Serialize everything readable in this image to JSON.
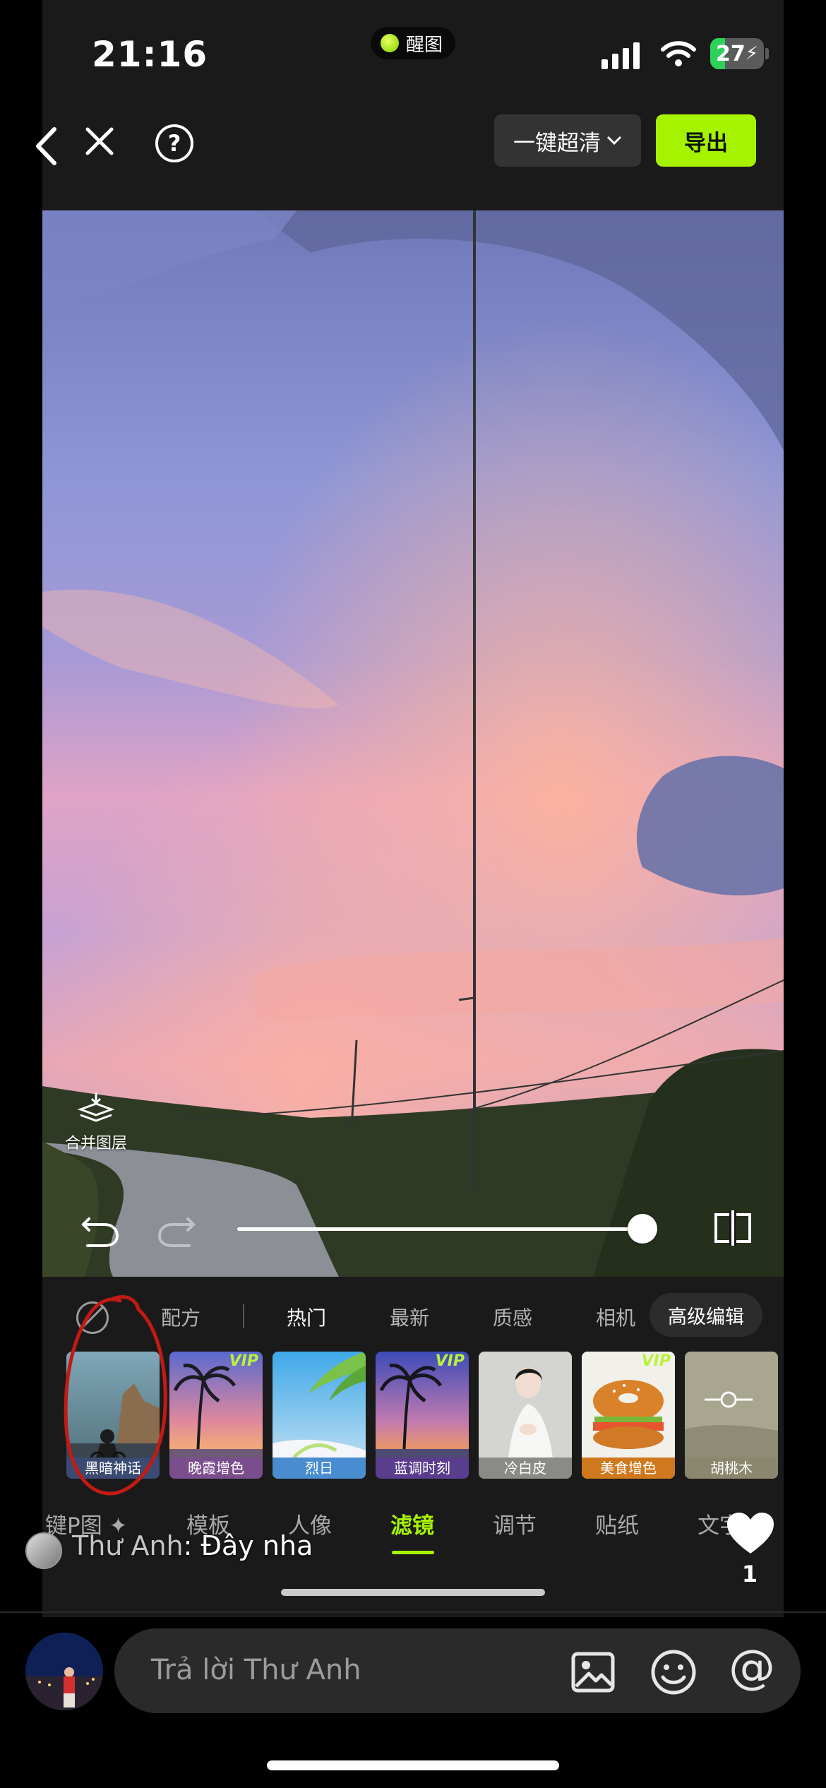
{
  "status_bar": {
    "time": "21:16",
    "island_label": "醒图",
    "battery": "27"
  },
  "toolbar": {
    "enhance_label": "一键超清",
    "export_label": "导出"
  },
  "canvas": {
    "merge_layers_label": "合并图层",
    "intensity_percent": 100
  },
  "filter_categories": {
    "items": [
      "配方",
      "热门",
      "最新",
      "质感",
      "相机"
    ],
    "active": "热门",
    "advanced_edit": "高级编辑"
  },
  "filters": [
    {
      "name": "黑暗神话",
      "vip": false
    },
    {
      "name": "晚霞增色",
      "vip": true
    },
    {
      "name": "烈日",
      "vip": false
    },
    {
      "name": "蓝调时刻",
      "vip": true
    },
    {
      "name": "冷白皮",
      "vip": false
    },
    {
      "name": "美食增色",
      "vip": true
    },
    {
      "name": "胡桃木",
      "vip": false
    }
  ],
  "vip_badge": "VIP",
  "tools": {
    "items": [
      "键P图 ✦",
      "模板",
      "人像",
      "滤镜",
      "调节",
      "贴纸",
      "文字"
    ],
    "active": "滤镜"
  },
  "comment": {
    "author": "Thư Anh",
    "text": "Đây nha"
  },
  "like_count": "1",
  "reply": {
    "placeholder": "Trả lời Thư Anh"
  },
  "colors": {
    "accent_green": "#a6f300",
    "annotation_red": "#c21a14"
  }
}
